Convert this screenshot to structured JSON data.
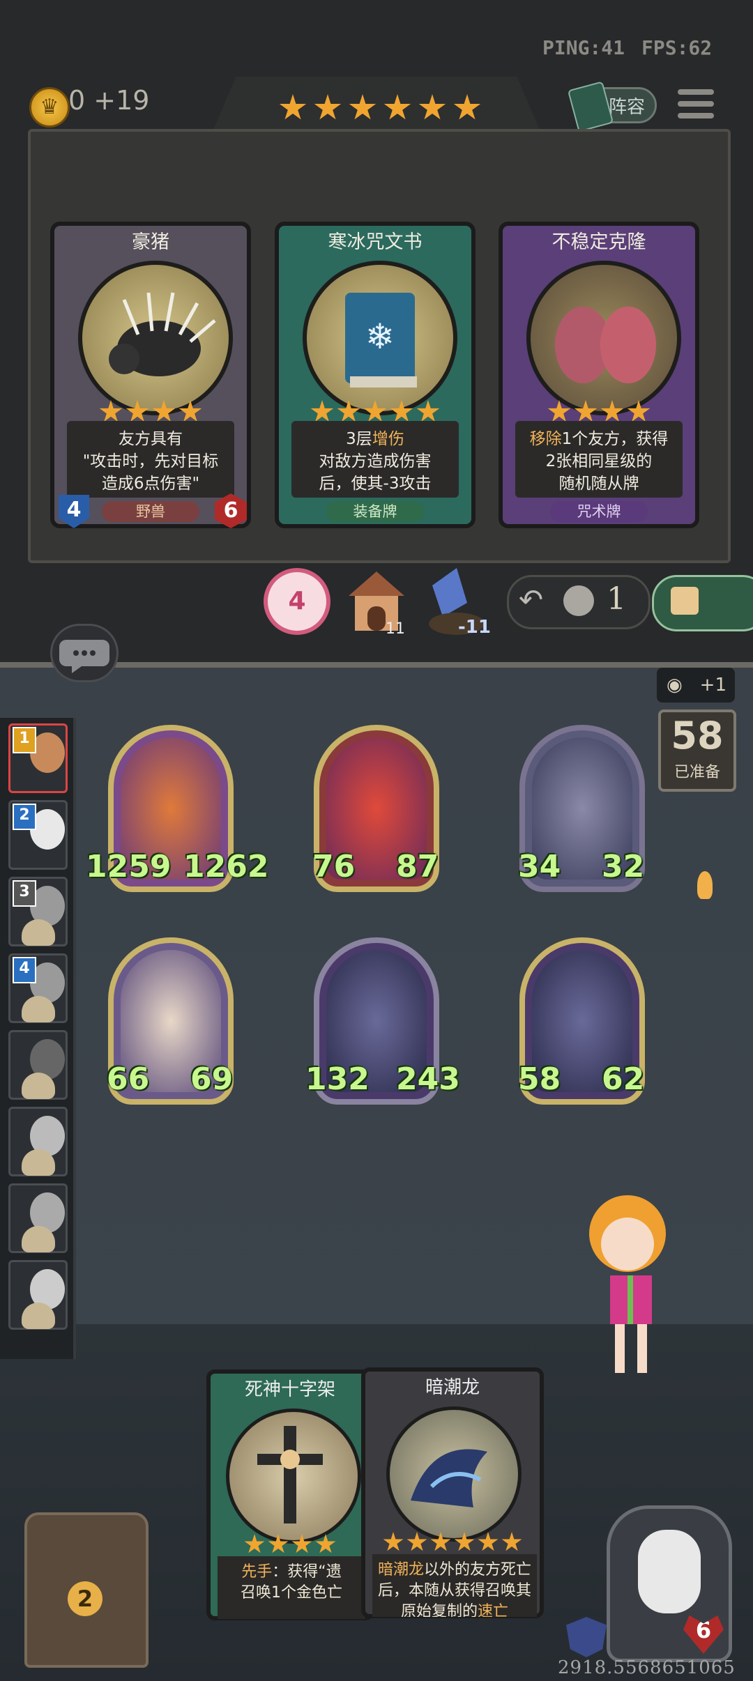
{
  "hud": {
    "ping": "PING:41",
    "fps": "FPS:62",
    "gold": "0 +19",
    "lineup_label": "阵容",
    "shop_stars": 6
  },
  "shop": [
    {
      "title": "豪猪",
      "desc_lines": [
        "友方具有",
        "\"攻击时，先对目标",
        "造成6点伤害\""
      ],
      "stars": 4,
      "tag": "野兽",
      "attack": "4",
      "health": "6",
      "theme": "#55505c"
    },
    {
      "title": "寒冰咒文书",
      "desc_prefix": "3层",
      "desc_hl": "增伤",
      "desc_lines": [
        "对敌方造成伤害",
        "后，使其-3攻击"
      ],
      "stars": 5,
      "tag": "装备牌",
      "theme": "#2c6a5e"
    },
    {
      "title": "不稳定克隆",
      "desc_prefix": "",
      "desc_hl": "移除",
      "desc_rest": "1个友方，获得",
      "desc_lines": [
        "2张相同星级的",
        "随机随从牌"
      ],
      "stars": 4,
      "tag": "咒术牌",
      "theme": "#5a3f78"
    }
  ],
  "controls": {
    "level": "4",
    "house_count": "11",
    "upgrade_count": "-11",
    "refresh_cost": "1"
  },
  "board": {
    "ready_count": "58",
    "ready_label": "已准备",
    "eye_plus": "+1",
    "units": [
      {
        "name": "fire-dragon",
        "attack": "1259",
        "health": "1262",
        "color": "#7a4a8a"
      },
      {
        "name": "red-dragon",
        "attack": "76",
        "health": "87",
        "color": "#8a3a3a"
      },
      {
        "name": "ghost-dragon",
        "attack": "34",
        "health": "32",
        "color": "#5a5a7a"
      },
      {
        "name": "clown",
        "attack": "66",
        "health": "69",
        "color": "#6a5a8a"
      },
      {
        "name": "dark-tide-dragon",
        "attack": "132",
        "health": "243",
        "color": "#4a3a6a"
      },
      {
        "name": "dark-tide-dragon-2",
        "attack": "58",
        "health": "62",
        "color": "#4a3a6a"
      }
    ]
  },
  "roster": [
    {
      "rank": "1"
    },
    {
      "rank": "2"
    },
    {
      "rank": "3"
    },
    {
      "rank": "4"
    },
    {
      "rank": ""
    },
    {
      "rank": ""
    },
    {
      "rank": ""
    },
    {
      "rank": ""
    }
  ],
  "hand": [
    {
      "title": "死神十字架",
      "hl1": "先手",
      "line1": "：获得“遗",
      "line2": "召唤1个金色亡",
      "stars": 4
    },
    {
      "title": "暗潮龙",
      "hl1": "暗潮龙",
      "line1": "以外的友方死亡",
      "line2": "后，本随从获得召唤其",
      "line3_start": "原始复制的",
      "line3_hl": "速亡",
      "stars": 6
    }
  ],
  "player": {
    "health": "6",
    "stash_count": "2"
  },
  "coords": "2918.5568651065"
}
